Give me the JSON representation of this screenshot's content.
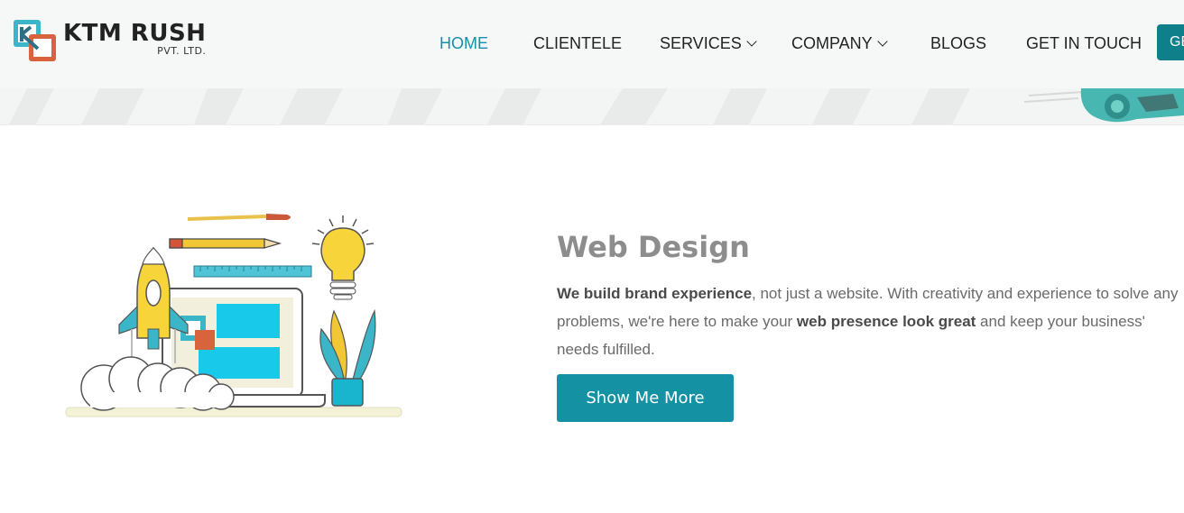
{
  "brand": {
    "name": "KTM RUSH",
    "sub": "PVT. LTD."
  },
  "nav": {
    "items": [
      {
        "label": "HOME",
        "active": true
      },
      {
        "label": "CLIENTELE"
      },
      {
        "label": "SERVICES",
        "dropdown": true
      },
      {
        "label": "COMPANY",
        "dropdown": true
      },
      {
        "label": "BLOGS"
      },
      {
        "label": "GET IN TOUCH"
      }
    ],
    "cta_label": "GE"
  },
  "section": {
    "title": "Web Design",
    "para": {
      "bold1": "We build brand experience",
      "text1": ", not just a website. With creativity and experience to solve any problems, we're here to make your ",
      "bold2": "web presence look great",
      "text2": " and keep your business' needs fulfilled."
    },
    "button_label": "Show Me More"
  },
  "colors": {
    "accent": "#1591a4",
    "nav_active": "#1a8ea8",
    "cta": "#0f7f8a",
    "logo_teal": "#3bb6c9",
    "logo_orange": "#d9633c"
  },
  "icons": [
    "chevron-down-icon",
    "logo-mark-icon"
  ]
}
